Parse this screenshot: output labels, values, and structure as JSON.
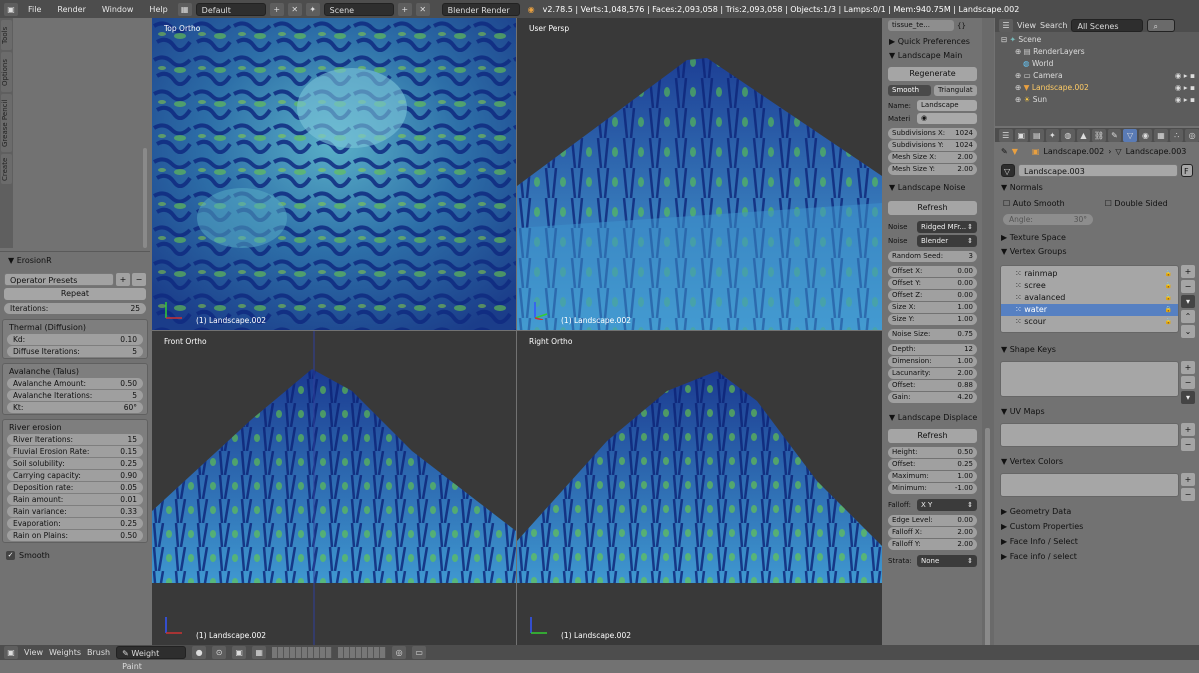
{
  "topbar": {
    "menus": [
      "File",
      "Render",
      "Window",
      "Help"
    ],
    "layout": "Default",
    "scene": "Scene",
    "engine": "Blender Render",
    "stats": "v2.78.5 | Verts:1,048,576 | Faces:2,093,058 | Tris:2,093,058 | Objects:1/3 | Lamps:0/1 | Mem:940.75M | Landscape.002"
  },
  "shelf": {
    "tabs": [
      "Tools",
      "Options",
      "Grease Pencil",
      "Create"
    ],
    "panel_title": "ErosionR",
    "presets": "Operator Presets",
    "repeat": "Repeat",
    "iterations": {
      "label": "Iterations:",
      "value": "25"
    },
    "thermal": {
      "title": "Thermal (Diffusion)",
      "fields": [
        {
          "label": "Kd:",
          "value": "0.10"
        },
        {
          "label": "Diffuse Iterations:",
          "value": "5"
        }
      ]
    },
    "avalanche": {
      "title": "Avalanche (Talus)",
      "fields": [
        {
          "label": "Avalanche Amount:",
          "value": "0.50"
        },
        {
          "label": "Avalanche Iterations:",
          "value": "5"
        },
        {
          "label": "Kt:",
          "value": "60°"
        }
      ]
    },
    "river": {
      "title": "River erosion",
      "fields": [
        {
          "label": "River Iterations:",
          "value": "15"
        },
        {
          "label": "Fluvial Erosion Rate:",
          "value": "0.15"
        },
        {
          "label": "Soil solubility:",
          "value": "0.25"
        },
        {
          "label": "Carrying capacity:",
          "value": "0.90"
        },
        {
          "label": "Deposition rate:",
          "value": "0.05"
        },
        {
          "label": "Rain amount:",
          "value": "0.01"
        },
        {
          "label": "Rain variance:",
          "value": "0.33"
        },
        {
          "label": "Evaporation:",
          "value": "0.25"
        },
        {
          "label": "Rain on Plains:",
          "value": "0.50"
        }
      ]
    },
    "smooth": "Smooth"
  },
  "viewports": [
    {
      "label": "Top Ortho",
      "obj": "(1) Landscape.002"
    },
    {
      "label": "User Persp",
      "obj": "(1) Landscape.002"
    },
    {
      "label": "Front Ortho",
      "obj": "(1) Landscape.002"
    },
    {
      "label": "Right Ortho",
      "obj": "(1) Landscape.002"
    }
  ],
  "npanel": {
    "top_field": "tissue_te...",
    "quick_prefs": "Quick Preferences",
    "main_title": "Landscape Main",
    "regenerate": "Regenerate",
    "smooth": "Smooth",
    "triangulate": "Triangulat",
    "name_label": "Name:",
    "name_value": "Landscape",
    "materi_label": "Materi",
    "main_fields": [
      {
        "label": "Subdivisions X:",
        "value": "1024"
      },
      {
        "label": "Subdivisions Y:",
        "value": "1024"
      },
      {
        "label": "Mesh Size X:",
        "value": "2.00"
      },
      {
        "label": "Mesh Size Y:",
        "value": "2.00"
      }
    ],
    "noise_title": "Landscape Noise",
    "refresh": "Refresh",
    "noise_label": "Noise",
    "noise_type": "Ridged MFr...",
    "noise_basis": "Blender",
    "random_seed": {
      "label": "Random Seed:",
      "value": "3"
    },
    "offsets": [
      {
        "label": "Offset X:",
        "value": "0.00"
      },
      {
        "label": "Offset Y:",
        "value": "0.00"
      },
      {
        "label": "Offset Z:",
        "value": "0.00"
      },
      {
        "label": "Size X:",
        "value": "1.00"
      },
      {
        "label": "Size Y:",
        "value": "1.00"
      }
    ],
    "noise_size": {
      "label": "Noise Size:",
      "value": "0.75"
    },
    "noise_fields": [
      {
        "label": "Depth:",
        "value": "12"
      },
      {
        "label": "Dimension:",
        "value": "1.00"
      },
      {
        "label": "Lacunarity:",
        "value": "2.00"
      },
      {
        "label": "Offset:",
        "value": "0.88"
      },
      {
        "label": "Gain:",
        "value": "4.20"
      }
    ],
    "displace_title": "Landscape Displace",
    "displace_fields": [
      {
        "label": "Height:",
        "value": "0.50"
      },
      {
        "label": "Offset:",
        "value": "0.25"
      },
      {
        "label": "Maximum:",
        "value": "1.00"
      },
      {
        "label": "Minimum:",
        "value": "-1.00"
      }
    ],
    "falloff_label": "Falloff:",
    "falloff_value": "X Y",
    "edge_fields": [
      {
        "label": "Edge Level:",
        "value": "0.00"
      },
      {
        "label": "Falloff X:",
        "value": "2.00"
      },
      {
        "label": "Falloff Y:",
        "value": "2.00"
      }
    ],
    "strata_label": "Strata:",
    "strata_value": "None"
  },
  "outliner": {
    "view": "View",
    "search": "Search",
    "scenes": "All Scenes",
    "items": [
      "Scene",
      "RenderLayers",
      "World",
      "Camera",
      "Landscape.002",
      "Sun"
    ]
  },
  "props": {
    "breadcrumb_obj": "Landscape.002",
    "breadcrumb_mesh": "Landscape.003",
    "mesh_name": "Landscape.003",
    "mesh_f": "F",
    "normals": "Normals",
    "auto_smooth": "Auto Smooth",
    "double_sided": "Double Sided",
    "angle": {
      "label": "Angle:",
      "value": "30°"
    },
    "texture_space": "Texture Space",
    "vertex_groups": "Vertex Groups",
    "groups": [
      "rainmap",
      "scree",
      "avalanced",
      "water",
      "scour"
    ],
    "active_group": "water",
    "shape_keys": "Shape Keys",
    "uv_maps": "UV Maps",
    "vertex_colors": "Vertex Colors",
    "geometry_data": "Geometry Data",
    "custom_props": "Custom Properties",
    "face_info1": "Face Info / Select",
    "face_info2": "Face info / select"
  },
  "bottombar": {
    "view": "View",
    "weights": "Weights",
    "brush": "Brush",
    "mode": "Weight Paint"
  }
}
